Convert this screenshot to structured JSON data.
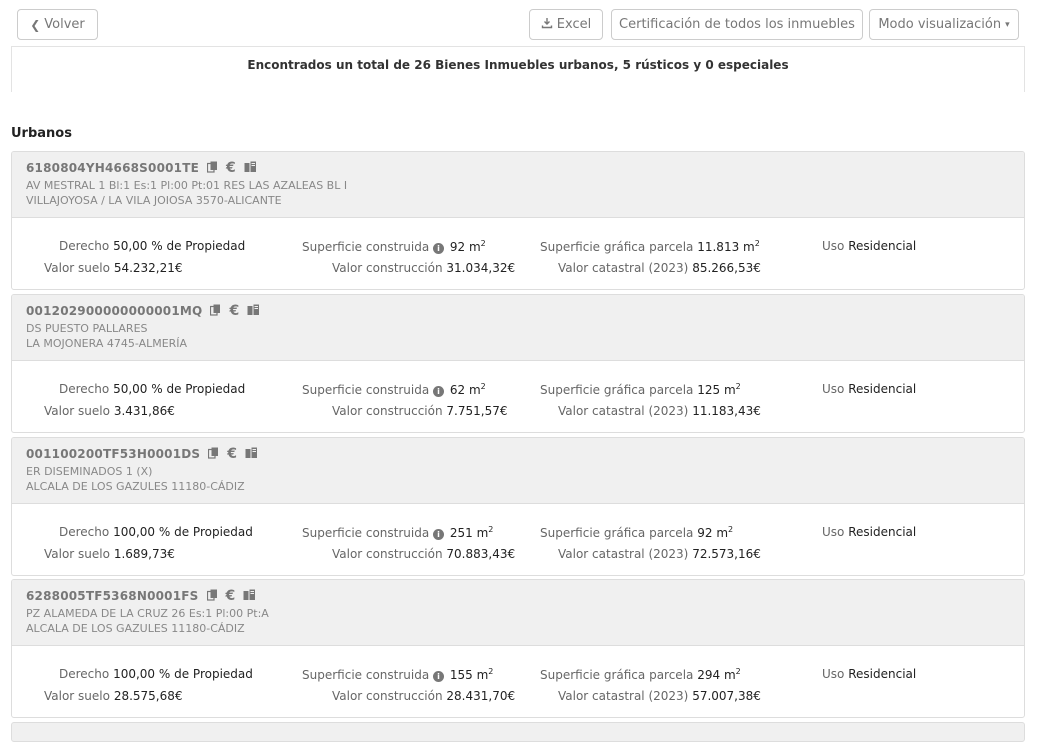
{
  "toolbar": {
    "back_icon": "chevron-left-icon",
    "back_label": "Volver",
    "excel_icon": "download-icon",
    "excel_label": "Excel",
    "cert_label": "Certificación de todos los inmuebles",
    "mode_label": "Modo visualización"
  },
  "summary": "Encontrados un total de 26 Bienes Inmuebles urbanos, 5 rústicos y 0 especiales",
  "section_title": "Urbanos",
  "labels": {
    "derecho": "Derecho",
    "de_propiedad": "de Propiedad",
    "superficie_construida": "Superficie construida",
    "superficie_grafica": "Superficie gráfica parcela",
    "uso": "Uso",
    "valor_suelo": "Valor suelo",
    "valor_construccion": "Valor construcción",
    "valor_catastral": "Valor catastral (2023)",
    "m2_unit": "m",
    "m2_sup": "2"
  },
  "properties": [
    {
      "ref": "6180804YH4668S0001TE",
      "addr1": "AV MESTRAL 1 Bl:1 Es:1 Pl:00 Pt:01 RES LAS AZALEAS BL I",
      "addr2": "VILLAJOYOSA / LA VILA JOIOSA 3570-ALICANTE",
      "derecho": "50,00 %",
      "sup_construida": "92",
      "sup_grafica": "11.813",
      "uso": "Residencial",
      "valor_suelo": "54.232,21€",
      "valor_construccion": "31.034,32€",
      "valor_catastral": "85.266,53€"
    },
    {
      "ref": "001202900000000001MQ",
      "addr1": "DS PUESTO PALLARES",
      "addr2": "LA MOJONERA 4745-ALMERÍA",
      "derecho": "50,00 %",
      "sup_construida": "62",
      "sup_grafica": "125",
      "uso": "Residencial",
      "valor_suelo": "3.431,86€",
      "valor_construccion": "7.751,57€",
      "valor_catastral": "11.183,43€"
    },
    {
      "ref": "001100200TF53H0001DS",
      "addr1": "ER DISEMINADOS 1 (X)",
      "addr2": "ALCALA DE LOS GAZULES 11180-CÁDIZ",
      "derecho": "100,00 %",
      "sup_construida": "251",
      "sup_grafica": "92",
      "uso": "Residencial",
      "valor_suelo": "1.689,73€",
      "valor_construccion": "70.883,43€",
      "valor_catastral": "72.573,16€"
    },
    {
      "ref": "6288005TF5368N0001FS",
      "addr1": "PZ ALAMEDA DE LA CRUZ 26 Es:1 Pl:00 Pt:A",
      "addr2": "ALCALA DE LOS GAZULES 11180-CÁDIZ",
      "derecho": "100,00 %",
      "sup_construida": "155",
      "sup_grafica": "294",
      "uso": "Residencial",
      "valor_suelo": "28.575,68€",
      "valor_construccion": "28.431,70€",
      "valor_catastral": "57.007,38€"
    }
  ]
}
